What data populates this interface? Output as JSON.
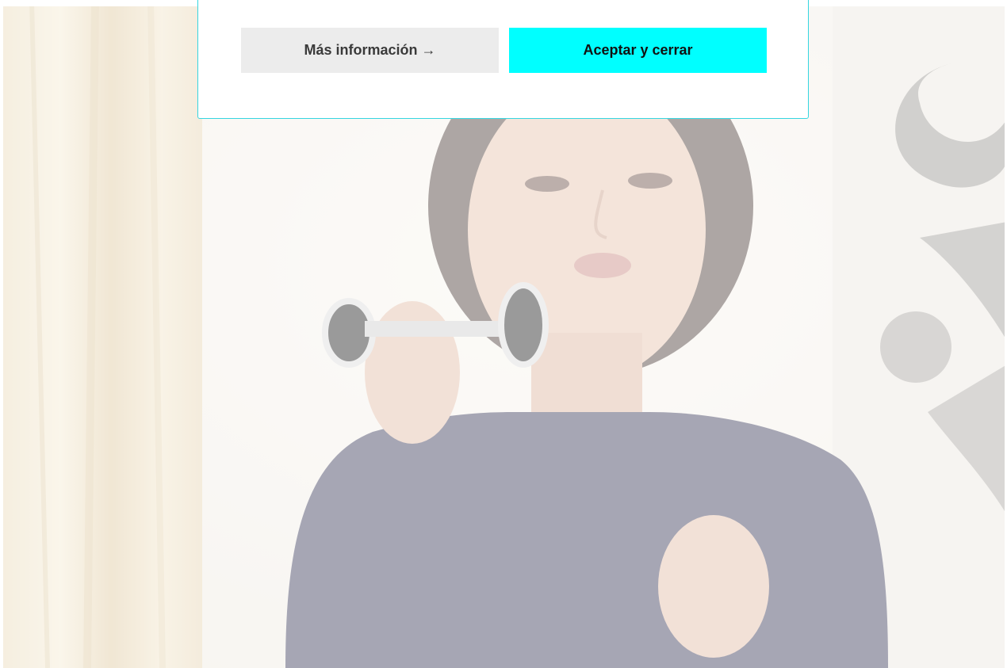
{
  "cookie_banner": {
    "more_info_label": "Más información →",
    "accept_label": "Aceptar y cerrar"
  },
  "colors": {
    "accent": "#00ffff",
    "banner_border": "#35d6e0",
    "secondary_button": "#ececec"
  },
  "background": {
    "icon": "photo-woman-with-face-roller"
  }
}
